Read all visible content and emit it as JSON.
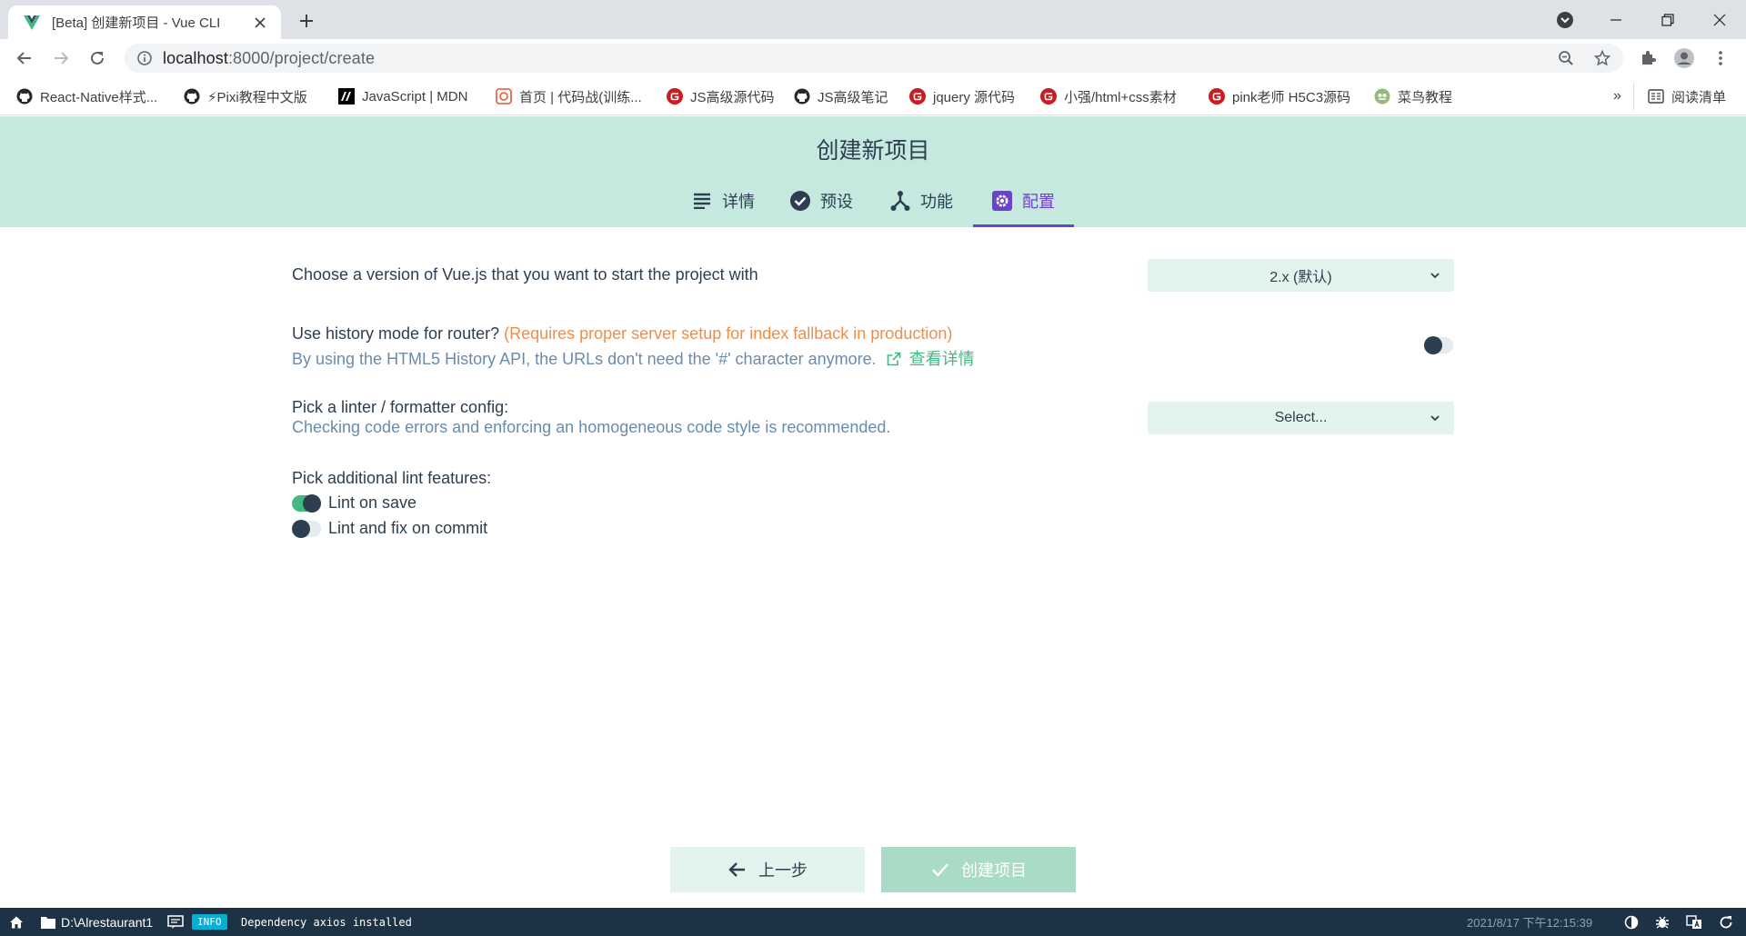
{
  "browser": {
    "tab_title": "[Beta] 创建新项目 - Vue CLI",
    "url_host": "localhost",
    "url_rest": ":8000/project/create",
    "bookmarks": [
      {
        "label": "React-Native样式...",
        "icon": "github-icon"
      },
      {
        "label": "⚡Pixi教程中文版",
        "icon": "github-icon"
      },
      {
        "label": "JavaScript | MDN",
        "icon": "mdn-icon"
      },
      {
        "label": "首页 | 代码战(训练...",
        "icon": "codewars-icon"
      },
      {
        "label": "JS高级源代码",
        "icon": "gitee-icon"
      },
      {
        "label": "JS高级笔记",
        "icon": "github-icon"
      },
      {
        "label": "jquery 源代码",
        "icon": "gitee-icon"
      },
      {
        "label": "小强/html+css素材",
        "icon": "gitee-icon"
      },
      {
        "label": "pink老师 H5C3源码",
        "icon": "gitee-icon"
      },
      {
        "label": "菜鸟教程",
        "icon": "runoob-icon"
      }
    ],
    "more_bookmarks": "»",
    "reading_list": "阅读清单"
  },
  "header": {
    "title": "创建新项目",
    "steps": [
      {
        "label": "详情",
        "icon": "list-icon"
      },
      {
        "label": "预设",
        "icon": "check-circle-icon"
      },
      {
        "label": "功能",
        "icon": "fork-icon"
      },
      {
        "label": "配置",
        "icon": "settings-icon"
      }
    ],
    "active_step": "配置"
  },
  "config": {
    "vue_version": {
      "label": "Choose a version of Vue.js that you want to start the project with",
      "value": "2.x (默认)"
    },
    "history_mode": {
      "label": "Use history mode for router?",
      "warning": "(Requires proper server setup for index fallback in production)",
      "description": "By using the HTML5 History API, the URLs don't need the '#' character anymore.",
      "link": "查看详情",
      "enabled": false
    },
    "linter": {
      "label": "Pick a linter / formatter config:",
      "description": "Checking code errors and enforcing an homogeneous code style is recommended.",
      "value": "Select..."
    },
    "lint_features": {
      "label": "Pick additional lint features:",
      "options": [
        {
          "label": "Lint on save",
          "enabled": true
        },
        {
          "label": "Lint and fix on commit",
          "enabled": false
        }
      ]
    }
  },
  "actions": {
    "prev": "上一步",
    "create": "创建项目"
  },
  "statusbar": {
    "cwd": "D:\\Alrestaurant1",
    "badge": "INFO",
    "message": "Dependency axios installed",
    "time": "2021/8/17 下午12:15:39"
  },
  "colors": {
    "header_bg": "#c6e9df",
    "accent_purple": "#6a43c9",
    "vue_green": "#42b983",
    "warning_orange": "#f08d49",
    "statusbar_bg": "#1e3246"
  }
}
